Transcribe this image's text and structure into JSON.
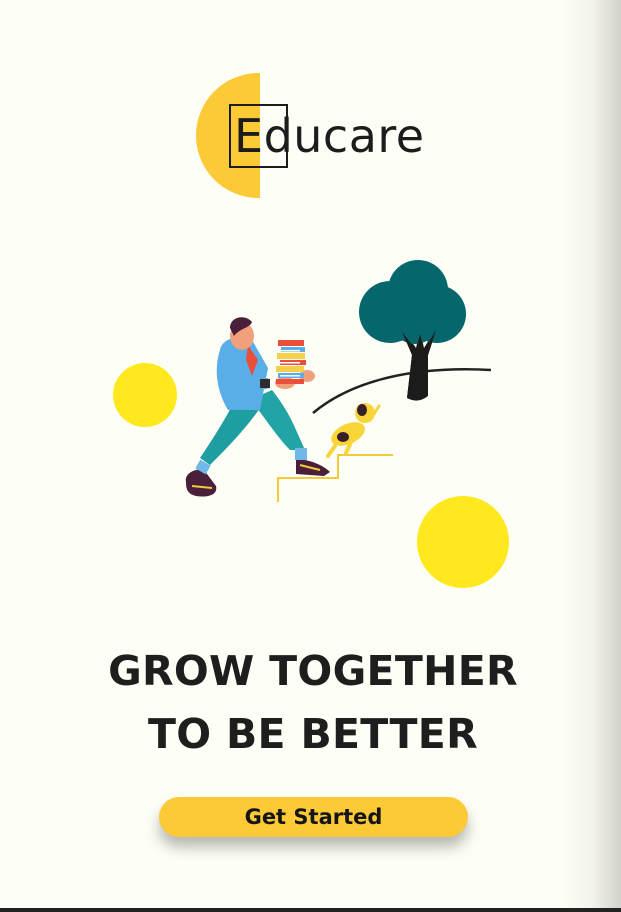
{
  "app": {
    "brand": "Educare"
  },
  "hero": {
    "headline_line1": "GROW TOGETHER",
    "headline_line2": "TO BE BETTER"
  },
  "actions": {
    "get_started_label": "Get Started"
  },
  "icons": {
    "logo": "half-circle-logo-mark",
    "illustration": "student-carrying-books-with-dog-and-tree"
  },
  "colors": {
    "background": "#fdfef5",
    "accent_yellow": "#fcc937",
    "circle_yellow": "#ffe81e",
    "tree_teal": "#05676b",
    "text_dark": "#1e1e1e"
  }
}
